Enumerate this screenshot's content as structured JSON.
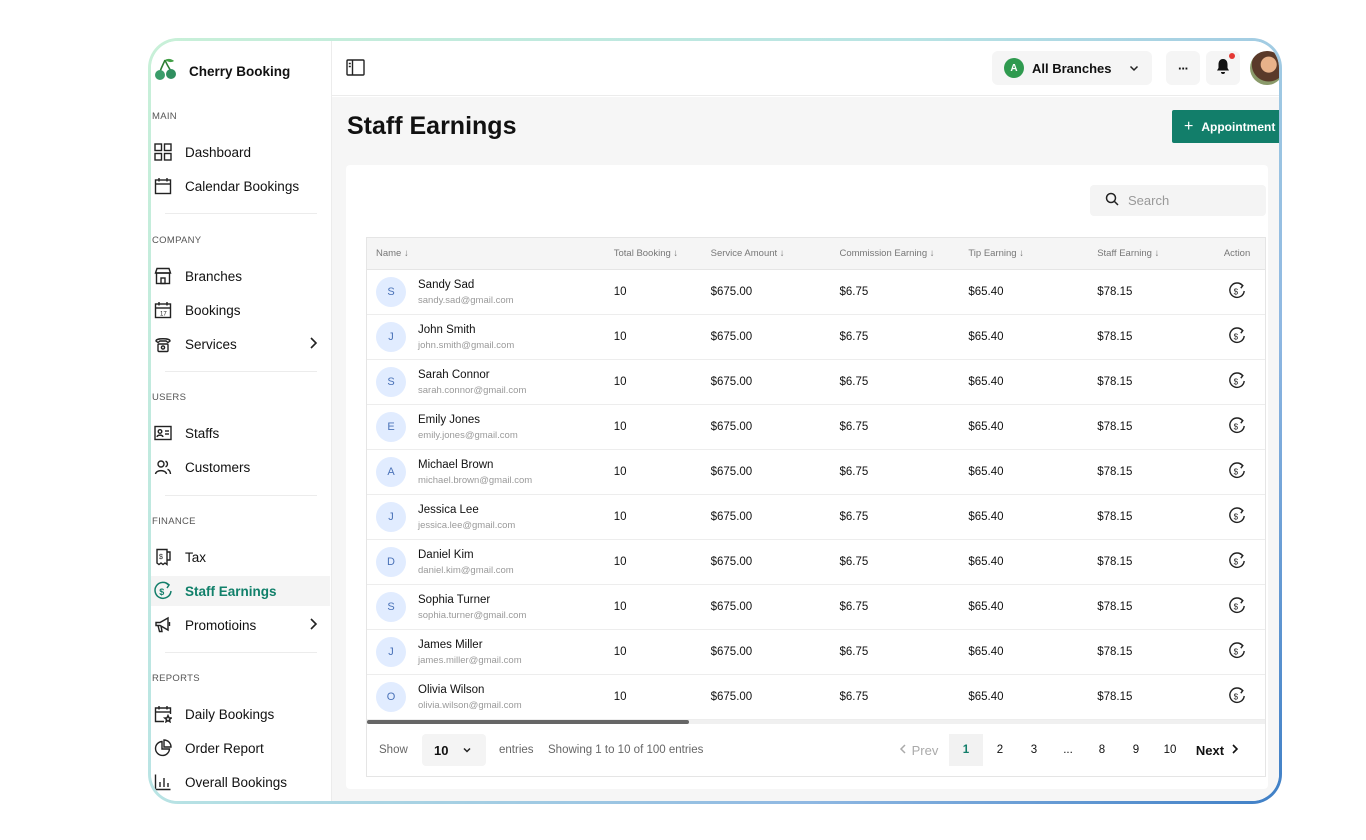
{
  "brand": {
    "name": "Cherry Booking"
  },
  "sidebar": {
    "sections": [
      {
        "label": "MAIN",
        "items": [
          {
            "label": "Dashboard",
            "icon": "dashboard-icon"
          },
          {
            "label": "Calendar Bookings",
            "icon": "calendar-icon"
          }
        ]
      },
      {
        "label": "COMPANY",
        "items": [
          {
            "label": "Branches",
            "icon": "branch-icon"
          },
          {
            "label": "Bookings",
            "icon": "booking-icon"
          },
          {
            "label": "Services",
            "icon": "services-icon"
          }
        ]
      },
      {
        "label": "USERS",
        "items": [
          {
            "label": "Staffs",
            "icon": "staff-icon"
          },
          {
            "label": "Customers",
            "icon": "customers-icon"
          }
        ]
      },
      {
        "label": "FINANCE",
        "items": [
          {
            "label": "Tax",
            "icon": "tax-icon"
          },
          {
            "label": "Staff Earnings",
            "icon": "earnings-icon"
          },
          {
            "label": "Promotioins",
            "icon": "megaphone-icon"
          }
        ]
      },
      {
        "label": "REPORTS",
        "items": [
          {
            "label": "Daily Bookings",
            "icon": "daily-bookings-icon"
          },
          {
            "label": "Order Report",
            "icon": "pie-chart-icon"
          },
          {
            "label": "Overall Bookings",
            "icon": "bar-chart-icon"
          }
        ]
      }
    ],
    "active": "Staff Earnings"
  },
  "topbar": {
    "branch_avatar": "A",
    "branch_label": "All Branches",
    "more_label": "···"
  },
  "page": {
    "title": "Staff Earnings",
    "appointment_button": "Appointment",
    "search_placeholder": "Search"
  },
  "table": {
    "headers": [
      "Name ↓",
      "Total Booking ↓",
      "Service Amount ↓",
      "Commission Earning ↓",
      "Tip Earning ↓",
      "Staff Earning ↓",
      "Action"
    ],
    "rows": [
      {
        "initial": "S",
        "name": "Sandy Sad",
        "email": "sandy.sad@gmail.com",
        "total_booking": "10",
        "service_amount": "$675.00",
        "commission": "$6.75",
        "tip": "$65.40",
        "staff_earning": "$78.15"
      },
      {
        "initial": "J",
        "name": "John Smith",
        "email": "john.smith@gmail.com",
        "total_booking": "10",
        "service_amount": "$675.00",
        "commission": "$6.75",
        "tip": "$65.40",
        "staff_earning": "$78.15"
      },
      {
        "initial": "S",
        "name": "Sarah Connor",
        "email": "sarah.connor@gmail.com",
        "total_booking": "10",
        "service_amount": "$675.00",
        "commission": "$6.75",
        "tip": "$65.40",
        "staff_earning": "$78.15"
      },
      {
        "initial": "E",
        "name": "Emily Jones",
        "email": "emily.jones@gmail.com",
        "total_booking": "10",
        "service_amount": "$675.00",
        "commission": "$6.75",
        "tip": "$65.40",
        "staff_earning": "$78.15"
      },
      {
        "initial": "A",
        "name": "Michael Brown",
        "email": "michael.brown@gmail.com",
        "total_booking": "10",
        "service_amount": "$675.00",
        "commission": "$6.75",
        "tip": "$65.40",
        "staff_earning": "$78.15"
      },
      {
        "initial": "J",
        "name": "Jessica Lee",
        "email": "jessica.lee@gmail.com",
        "total_booking": "10",
        "service_amount": "$675.00",
        "commission": "$6.75",
        "tip": "$65.40",
        "staff_earning": "$78.15"
      },
      {
        "initial": "D",
        "name": "Daniel Kim",
        "email": "daniel.kim@gmail.com",
        "total_booking": "10",
        "service_amount": "$675.00",
        "commission": "$6.75",
        "tip": "$65.40",
        "staff_earning": "$78.15"
      },
      {
        "initial": "S",
        "name": "Sophia Turner",
        "email": "sophia.turner@gmail.com",
        "total_booking": "10",
        "service_amount": "$675.00",
        "commission": "$6.75",
        "tip": "$65.40",
        "staff_earning": "$78.15"
      },
      {
        "initial": "J",
        "name": "James Miller",
        "email": "james.miller@gmail.com",
        "total_booking": "10",
        "service_amount": "$675.00",
        "commission": "$6.75",
        "tip": "$65.40",
        "staff_earning": "$78.15"
      },
      {
        "initial": "O",
        "name": "Olivia Wilson",
        "email": "olivia.wilson@gmail.com",
        "total_booking": "10",
        "service_amount": "$675.00",
        "commission": "$6.75",
        "tip": "$65.40",
        "staff_earning": "$78.15"
      }
    ]
  },
  "footer": {
    "show_label": "Show",
    "per_page": "10",
    "entries_label": "entries",
    "showing_text": "Showing 1 to 10 of 100 entries",
    "prev": "Prev",
    "next": "Next",
    "pages": [
      "1",
      "2",
      "3",
      "...",
      "8",
      "9",
      "10"
    ],
    "current_page": "1"
  },
  "colors": {
    "accent": "#127e6a",
    "avatar_bg": "#e1ecff",
    "notification_dot": "#e53935"
  }
}
